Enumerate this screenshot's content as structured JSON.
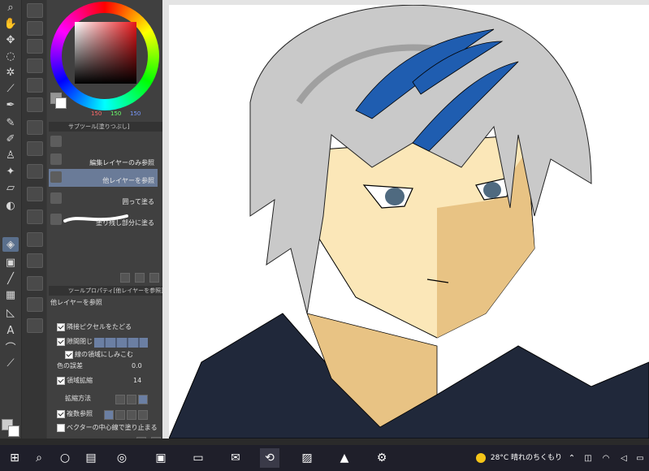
{
  "tools": {
    "icons": [
      "search-icon",
      "hand-icon",
      "move-icon",
      "lasso-icon",
      "magic-wand-icon",
      "eyedropper-icon",
      "pen-icon",
      "pencil-icon",
      "brush-icon",
      "airbrush-icon",
      "decoration-icon",
      "eraser-icon",
      "blend-icon",
      "fill-icon",
      "gradient-icon",
      "figure-icon",
      "frame-icon",
      "ruler-icon",
      "text-icon",
      "balloon-icon",
      "correction-icon"
    ]
  },
  "color": {
    "r": "150",
    "g": "150",
    "b": "150",
    "main_color": "#969696",
    "sub_color": "#ffffff"
  },
  "subtool": {
    "header": "サブツール[塗りつぶし]",
    "items": [
      {
        "label": "",
        "icon": "fill-bucket-icon"
      },
      {
        "label": "編集レイヤーのみ参照",
        "icon": "fill-bucket-icon"
      },
      {
        "label": "他レイヤーを参照",
        "icon": "fill-bucket-icon"
      },
      {
        "label": "囲って塗る",
        "icon": "lasso-fill-icon"
      },
      {
        "label": "塗り残し部分に塗る",
        "icon": "brush-stroke-icon"
      }
    ]
  },
  "toolprop": {
    "header": "ツールプロパティ[他レイヤーを参照]",
    "title": "他レイヤーを参照",
    "adjacent": "隣接ピクセルをたどる",
    "gap_close": "隙間閉じ",
    "fill_inner": "線の領域にしみこむ",
    "color_tolerance_label": "色の誤差",
    "color_tolerance_value": "0.0",
    "area_scaling": "領域拡縮",
    "area_scaling_value": "14",
    "scaling_method": "拡縮方法",
    "multiple_reference": "複数参照",
    "vector_center": "ベクターの中心線で塗り止まる"
  },
  "taskbar": {
    "temperature": "28°C",
    "weather": "晴れのちくもり",
    "apps": [
      "start-icon",
      "search-icon",
      "cortana-icon",
      "task-view-icon",
      "edge-icon",
      "store-icon",
      "explorer-icon",
      "mail-icon",
      "clipstudio-icon",
      "paint-icon",
      "photos-icon",
      "settings-icon"
    ]
  },
  "colors": {
    "hair": "#c9c9c9",
    "hair_shadow": "#a0a0a0",
    "highlight_blue": "#1f5db0",
    "skin": "#fbe7b8",
    "skin_shadow": "#e8c384",
    "shirt": "#20283a",
    "eyes": "#4f6a80"
  }
}
